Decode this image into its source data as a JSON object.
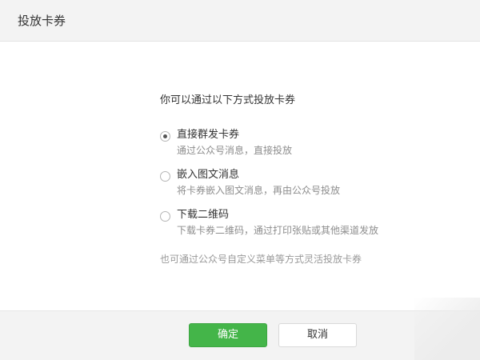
{
  "dialog": {
    "title": "投放卡券"
  },
  "intro": "你可以通过以下方式投放卡券",
  "options": [
    {
      "label": "直接群发卡券",
      "description": "通过公众号消息，直接投放",
      "checked": true
    },
    {
      "label": "嵌入图文消息",
      "description": "将卡券嵌入图文消息，再由公众号投放",
      "checked": false
    },
    {
      "label": "下载二维码",
      "description": "下载卡券二维码，通过打印张贴或其他渠道发放",
      "checked": false
    }
  ],
  "footnote": "也可通过公众号自定义菜单等方式灵活投放卡券",
  "footer": {
    "confirm_label": "确定",
    "cancel_label": "取消"
  },
  "colors": {
    "accent": "#44b549",
    "header_bg": "#f3f3f3",
    "text": "#333333",
    "muted": "#8d8d8d"
  }
}
